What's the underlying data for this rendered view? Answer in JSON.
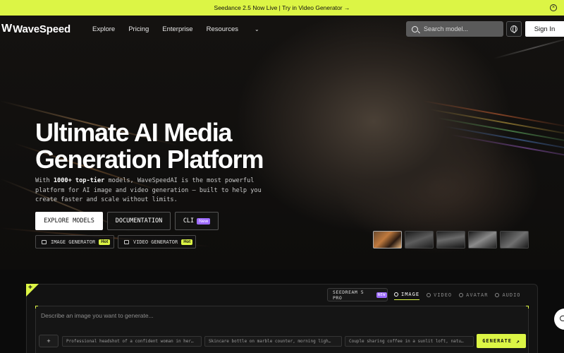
{
  "banner": {
    "text": "Seedance 2.5 Now Live | Try in Video Generator →",
    "close_icon": "close-circle-icon"
  },
  "nav": {
    "logo_mark": "W",
    "logo_text": "WaveSpeed",
    "links": [
      "Explore",
      "Pricing",
      "Enterprise",
      "Resources"
    ],
    "search_placeholder": "Search model...",
    "signin": "Sign In"
  },
  "hero": {
    "title": "Ultimate AI Media Generation Platform",
    "subtitle_prefix": "With ",
    "subtitle_bold": "1000+ top-tier",
    "subtitle_rest": " models, WaveSpeedAI is the most powerful platform for AI image and video generation — built to help you create faster and scale without limits.",
    "buttons": {
      "explore": "EXPLORE MODELS",
      "docs": "DOCUMENTATION",
      "cli": "CLI",
      "cli_badge": "New"
    },
    "chips": [
      {
        "label": "IMAGE GENERATOR",
        "badge": "Hot"
      },
      {
        "label": "VIDEO GENERATOR",
        "badge": "Hot"
      }
    ]
  },
  "generator": {
    "plus": "+",
    "model": "SEEDREAM 5 PRO",
    "model_badge": "NEW",
    "modes": [
      "IMAGE",
      "VIDEO",
      "AVATAR",
      "AUDIO"
    ],
    "active_mode": "IMAGE",
    "prompt_placeholder": "Describe an image you want to generate...",
    "attach": "+",
    "suggestions": [
      "Professional headshot of a confident woman in her…",
      "Skincare bottle on marble counter, morning ligh…",
      "Couple sharing coffee in a sunlit loft, natu…"
    ],
    "generate": "GENERATE",
    "generate_arrow": "↗"
  },
  "colors": {
    "accent": "#dcf545",
    "badge_new": "#9d6bff"
  }
}
